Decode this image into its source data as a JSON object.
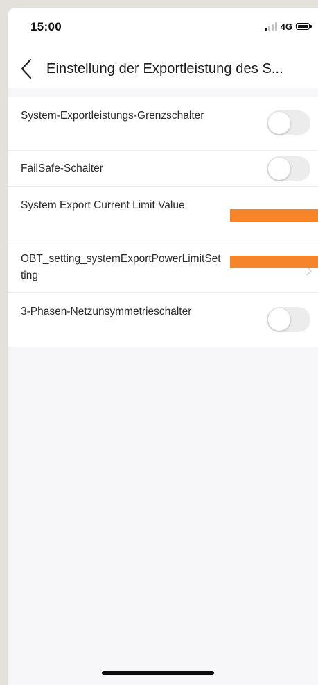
{
  "status_bar": {
    "time": "15:00",
    "network": "4G",
    "signal_bars_active": 1,
    "signal_bars_total": 4
  },
  "nav": {
    "title": "Einstellung der Exportleistung des S..."
  },
  "settings": [
    {
      "label": "System-Exportleistungs-Grenzschalter",
      "control": "toggle",
      "on": false
    },
    {
      "label": "FailSafe-Schalter",
      "control": "toggle",
      "on": false
    },
    {
      "label": "System Export Current Limit Value",
      "control": "value-redacted"
    },
    {
      "label": "OBT_setting_systemExportPowerLimitSetting",
      "control": "chevron-redacted"
    },
    {
      "label": "3-Phasen-Netzunsymmetrieschalter",
      "control": "toggle",
      "on": false
    }
  ],
  "colors": {
    "background": "#f7f7f9",
    "surface": "#ffffff",
    "redaction": "#f5842b",
    "toggle_off_track": "#ececec"
  }
}
